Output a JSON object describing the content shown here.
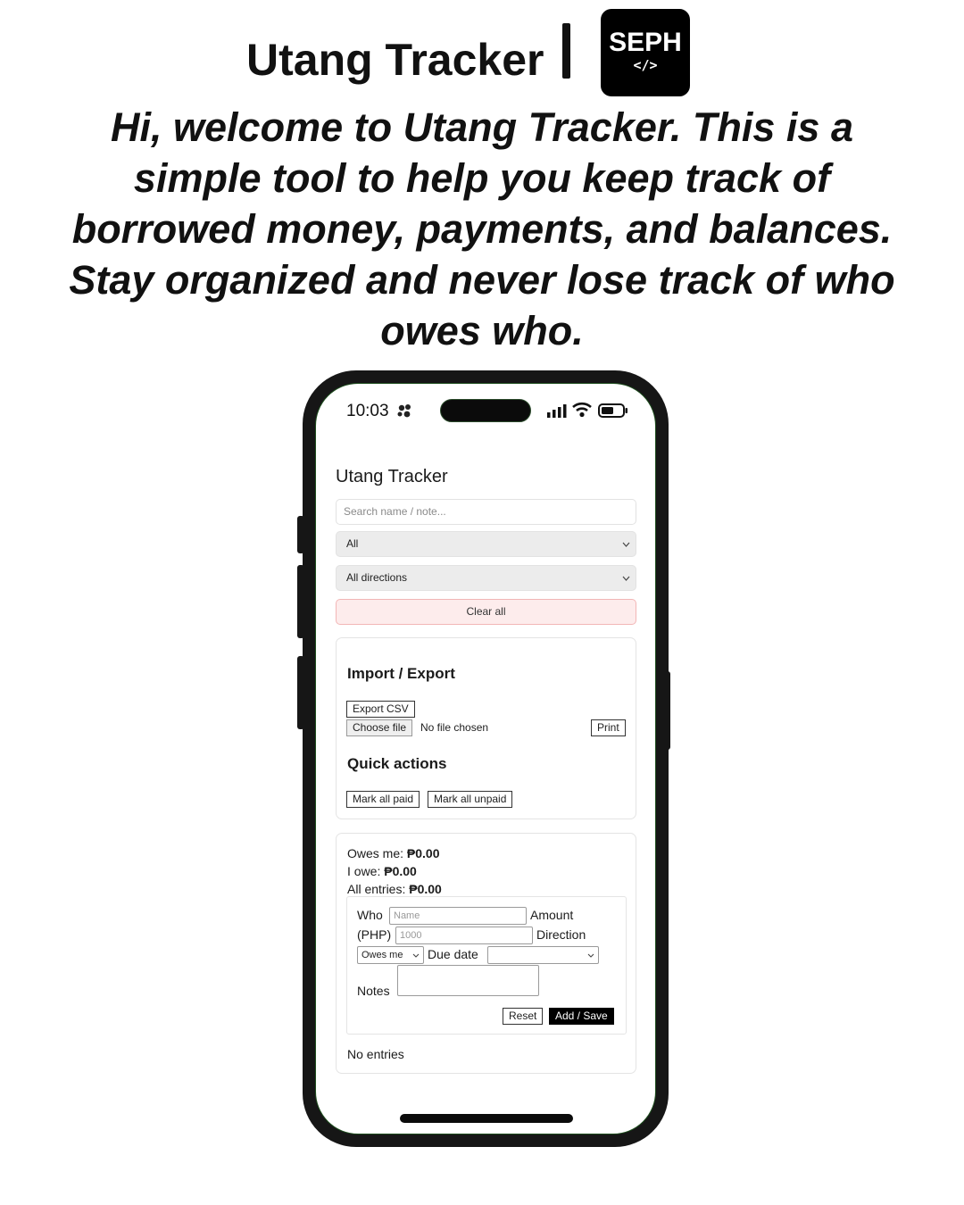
{
  "header": {
    "title": "Utang Tracker",
    "logo_text": "SEPH",
    "logo_tag": "</>",
    "intro": "Hi, welcome to Utang Tracker. This is a simple tool to help you keep track of borrowed money, payments, and balances. Stay organized and never lose track of who owes who."
  },
  "status_bar": {
    "time": "10:03"
  },
  "app": {
    "title": "Utang Tracker",
    "search_placeholder": "Search name / note...",
    "filter_status": "All",
    "filter_direction": "All directions",
    "clear_all_label": "Clear all",
    "import_export": {
      "heading": "Import / Export",
      "export_csv_label": "Export CSV",
      "choose_file_label": "Choose file",
      "file_status": "No file chosen",
      "print_label": "Print"
    },
    "quick_actions": {
      "heading": "Quick actions",
      "mark_all_paid_label": "Mark all paid",
      "mark_all_unpaid_label": "Mark all unpaid"
    },
    "totals": {
      "owes_me_label": "Owes me:",
      "owes_me_value": "₱0.00",
      "i_owe_label": "I owe:",
      "i_owe_value": "₱0.00",
      "all_entries_label": "All entries:",
      "all_entries_value": "₱0.00"
    },
    "form": {
      "who_label": "Who",
      "who_placeholder": "Name",
      "amount_label": "Amount",
      "php_label": "(PHP)",
      "amount_placeholder": "1000",
      "direction_label": "Direction",
      "direction_value": "Owes me",
      "due_date_label": "Due date",
      "due_date_value": "",
      "notes_label": "Notes",
      "reset_label": "Reset",
      "save_label": "Add / Save"
    },
    "empty_state": "No entries"
  }
}
